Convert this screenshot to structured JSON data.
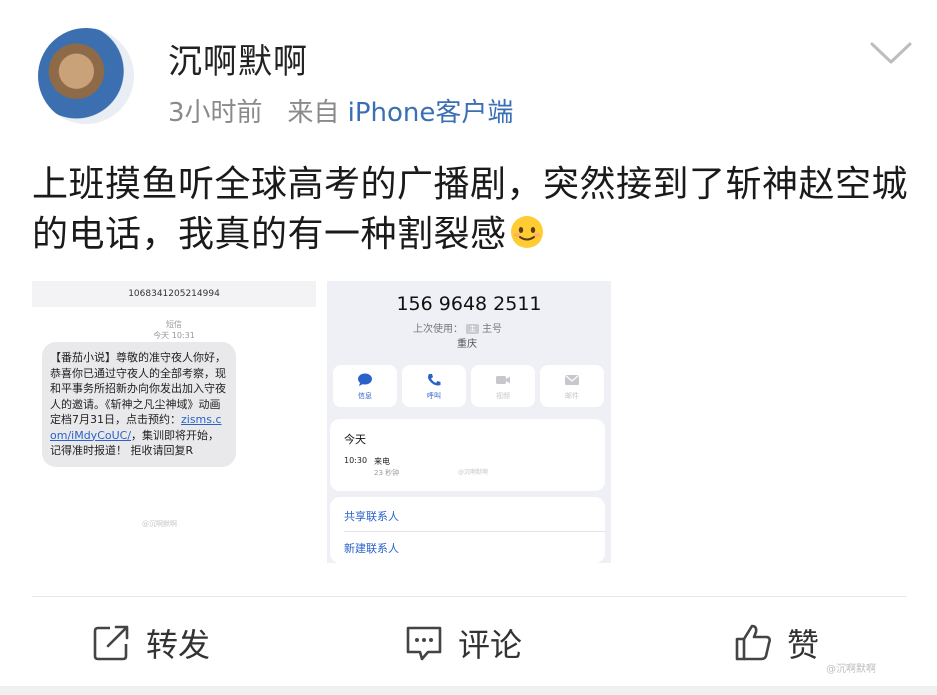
{
  "post": {
    "username": "沉啊默啊",
    "time_ago": "3小时前",
    "from_label": "来自",
    "client": "iPhone客户端",
    "text": "上班摸鱼听全球高考的广播剧，突然接到了斩神赵空城的电话，我真的有一种割裂感"
  },
  "sms_shot": {
    "number": "1068341205214994",
    "kind": "短信",
    "time": "今天 10:31",
    "message_before_link": "【番茄小说】尊敬的准守夜人你好，恭喜你已通过守夜人的全部考察，现和平事务所招新办向你发出加入守夜人的邀请。《斩神之凡尘神域》动画定档7月31日，点击预约：",
    "link": "zisms.com/iMdyCoUC/",
    "message_after_link": "，集训即将开始，记得准时报道！ 拒收请回复R",
    "watermark": "@沉啊默啊"
  },
  "contact_shot": {
    "phone": "156 9648 2511",
    "last_used_label": "上次使用：",
    "sim": "主",
    "sim_label": "主号",
    "city": "重庆",
    "actions": [
      {
        "label": "信息",
        "icon": "message-icon"
      },
      {
        "label": "呼叫",
        "icon": "phone-icon"
      },
      {
        "label": "视频",
        "icon": "video-icon"
      },
      {
        "label": "邮件",
        "icon": "mail-icon"
      }
    ],
    "today": "今天",
    "call_time": "10:30",
    "call_type": "来电",
    "call_duration": "23 秒钟",
    "watermark": "@沉啊默啊",
    "share_contact": "共享联系人",
    "new_contact": "新建联系人"
  },
  "footer": {
    "repost": "转发",
    "comment": "评论",
    "like": "赞",
    "watermark": "@沉啊默啊"
  },
  "colors": {
    "link_blue": "#3a6fb5",
    "meta_gray": "#8a8a8a",
    "ios_blue": "#2a62c9"
  }
}
